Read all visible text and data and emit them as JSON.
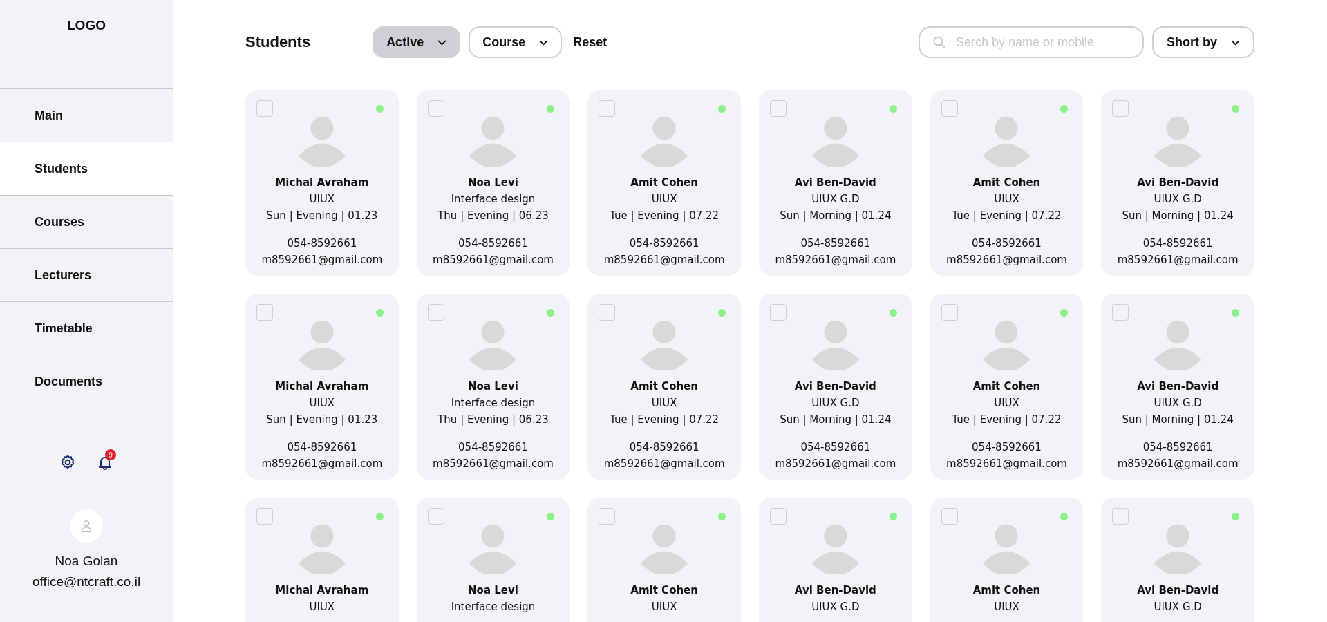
{
  "sidebar": {
    "logo": "LOGO",
    "nav": [
      {
        "label": "Main",
        "selected": false
      },
      {
        "label": "Students",
        "selected": true
      },
      {
        "label": "Courses",
        "selected": false
      },
      {
        "label": "Lecturers",
        "selected": false
      },
      {
        "label": "Timetable",
        "selected": false
      },
      {
        "label": "Documents",
        "selected": false
      }
    ],
    "notifications": {
      "count": "9"
    },
    "user": {
      "name": "Noa Golan",
      "email": "office@ntcraft.co.il"
    }
  },
  "header": {
    "title": "Students",
    "filters": [
      {
        "label": "Active",
        "selected": true
      },
      {
        "label": "Course",
        "selected": false
      }
    ],
    "reset": "Reset",
    "search": {
      "placeholder": "Serch by name or mobile"
    },
    "sort": "Short by"
  },
  "cards": [
    {
      "checked": false,
      "color": "#8ef08a",
      "name": "Michal Avraham",
      "course": "UIUX",
      "schedule": "Sun | Evening | 01.23",
      "phone": "054-8592661",
      "email": "m8592661@gmail.com"
    },
    {
      "checked": false,
      "color": "#8ef08a",
      "name": "Noa Levi",
      "course": "Interface design",
      "schedule": "Thu | Evening | 06.23",
      "phone": "054-8592661",
      "email": "m8592661@gmail.com"
    },
    {
      "checked": false,
      "color": "#8ef08a",
      "name": "Amit Cohen",
      "course": "UIUX",
      "schedule": "Tue | Evening | 07.22",
      "phone": "054-8592661",
      "email": "m8592661@gmail.com"
    },
    {
      "checked": false,
      "color": "#8ef08a",
      "name": "Avi Ben-David",
      "course": "UIUX G.D",
      "schedule": "Sun | Morning | 01.24",
      "phone": "054-8592661",
      "email": "m8592661@gmail.com"
    },
    {
      "checked": false,
      "color": "#8ef08a",
      "name": "Amit Cohen",
      "course": "UIUX",
      "schedule": "Tue | Evening | 07.22",
      "phone": "054-8592661",
      "email": "m8592661@gmail.com"
    },
    {
      "checked": false,
      "color": "#8ef08a",
      "name": "Avi Ben-David",
      "course": "UIUX G.D",
      "schedule": "Sun | Morning | 01.24",
      "phone": "054-8592661",
      "email": "m8592661@gmail.com"
    },
    {
      "checked": false,
      "color": "#8ef08a",
      "name": "Michal Avraham",
      "course": "UIUX",
      "schedule": "Sun | Evening | 01.23",
      "phone": "054-8592661",
      "email": "m8592661@gmail.com"
    },
    {
      "checked": false,
      "color": "#8ef08a",
      "name": "Noa Levi",
      "course": "Interface design",
      "schedule": "Thu | Evening | 06.23",
      "phone": "054-8592661",
      "email": "m8592661@gmail.com"
    },
    {
      "checked": false,
      "color": "#8ef08a",
      "name": "Amit Cohen",
      "course": "UIUX",
      "schedule": "Tue | Evening | 07.22",
      "phone": "054-8592661",
      "email": "m8592661@gmail.com"
    },
    {
      "checked": false,
      "color": "#8ef08a",
      "name": "Avi Ben-David",
      "course": "UIUX G.D",
      "schedule": "Sun | Morning | 01.24",
      "phone": "054-8592661",
      "email": "m8592661@gmail.com"
    },
    {
      "checked": false,
      "color": "#8ef08a",
      "name": "Amit Cohen",
      "course": "UIUX",
      "schedule": "Tue | Evening | 07.22",
      "phone": "054-8592661",
      "email": "m8592661@gmail.com"
    },
    {
      "checked": false,
      "color": "#8ef08a",
      "name": "Avi Ben-David",
      "course": "UIUX G.D",
      "schedule": "Sun | Morning | 01.24",
      "phone": "054-8592661",
      "email": "m8592661@gmail.com"
    },
    {
      "checked": false,
      "color": "#8ef08a",
      "name": "Michal Avraham",
      "course": "UIUX"
    },
    {
      "checked": false,
      "color": "#8ef08a",
      "name": "Noa Levi",
      "course": "Interface design"
    },
    {
      "checked": false,
      "color": "#8ef08a",
      "name": "Amit Cohen",
      "course": "UIUX"
    },
    {
      "checked": false,
      "color": "#8ef08a",
      "name": "Avi Ben-David",
      "course": "UIUX G.D"
    },
    {
      "checked": false,
      "color": "#8ef08a",
      "name": "Amit Cohen",
      "course": "UIUX"
    },
    {
      "checked": false,
      "color": "#8ef08a",
      "name": "Avi Ben-David",
      "course": "UIUX G.D"
    }
  ]
}
